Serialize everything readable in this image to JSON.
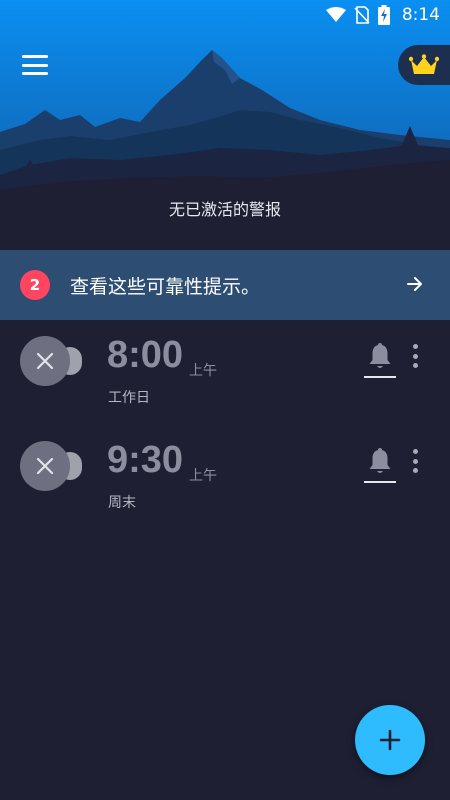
{
  "status_bar": {
    "time": "8:14"
  },
  "header": {
    "empty_state_text": "无已激活的警报"
  },
  "tips": {
    "badge_count": "2",
    "text": "查看这些可靠性提示。"
  },
  "alarms": [
    {
      "time": "8:00",
      "ampm": "上午",
      "days": "工作日",
      "enabled": false
    },
    {
      "time": "9:30",
      "ampm": "上午",
      "days": "周末",
      "enabled": false
    }
  ],
  "colors": {
    "sky_top": "#0a8ff2",
    "background": "#1e1f33",
    "tips_bar": "#2e4d73",
    "badge": "#ff4560",
    "fab": "#2ebcff",
    "crown": "#ffd21f"
  },
  "icons": [
    "wifi-icon",
    "no-sim-icon",
    "battery-charging-icon",
    "menu-icon",
    "crown-icon",
    "arrow-right-icon",
    "close-icon",
    "bell-icon",
    "more-vert-icon",
    "plus-icon"
  ]
}
